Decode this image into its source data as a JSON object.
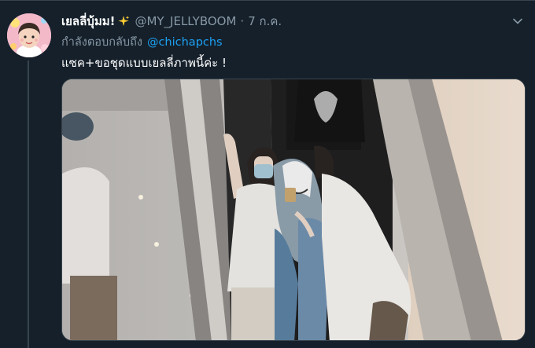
{
  "tweet": {
    "display_name": "เยลลี่บุ้มม!",
    "handle": "@MY_JELLYBOOM",
    "separator": "·",
    "date": "7 ก.ค.",
    "reply_prefix": "กำลังตอบกลับถึง",
    "reply_to": "@chichapchs",
    "text": "แซค+ขอชุดแบบเยลลี่ภาพนี้ค่ะ !"
  },
  "icons": {
    "sparkle": "sparkles-emoji-icon",
    "more": "chevron-down-icon"
  },
  "colors": {
    "background": "#15202b",
    "secondary_text": "#8899a6",
    "link": "#1da1f2",
    "border": "#38444d"
  }
}
